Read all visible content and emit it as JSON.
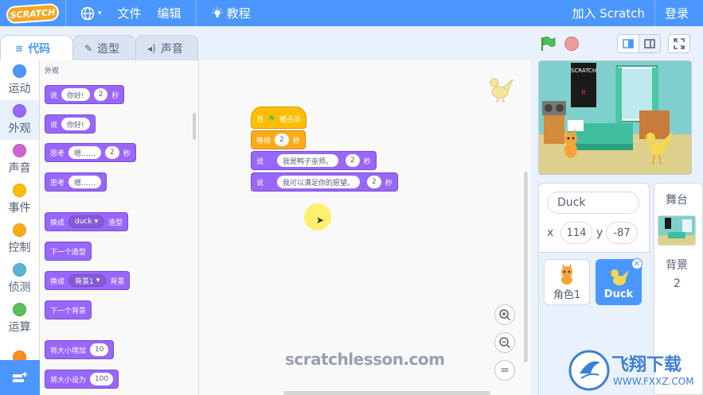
{
  "menu": {
    "logo": "SCRATCH",
    "file": "文件",
    "edit": "编辑",
    "tutorials": "教程",
    "join": "加入 Scratch",
    "signin": "登录"
  },
  "tabs": [
    {
      "label": "代码"
    },
    {
      "label": "造型"
    },
    {
      "label": "声音"
    }
  ],
  "categories": [
    {
      "label": "运动",
      "color": "#4c97ff"
    },
    {
      "label": "外观",
      "color": "#9966ff"
    },
    {
      "label": "声音",
      "color": "#cf63cf"
    },
    {
      "label": "事件",
      "color": "#ffbf00"
    },
    {
      "label": "控制",
      "color": "#ffab19"
    },
    {
      "label": "侦测",
      "color": "#5cb1d6"
    },
    {
      "label": "运算",
      "color": "#59c059"
    },
    {
      "label": "",
      "color": "#ff8c1a"
    }
  ],
  "palette": {
    "section_title": "外观",
    "say_for": {
      "say": "说",
      "text": "你好!",
      "secs": "2",
      "unit": "秒"
    },
    "say": {
      "say": "说",
      "text": "你好!"
    },
    "think_for": {
      "think": "思考",
      "text": "嗯……",
      "secs": "2",
      "unit": "秒"
    },
    "think": {
      "think": "思考",
      "text": "嗯……"
    },
    "switch_costume": {
      "prefix": "换成",
      "value": "duck",
      "suffix": "造型"
    },
    "next_costume": "下一个造型",
    "switch_backdrop": {
      "prefix": "换成",
      "value": "背景1",
      "suffix": "背景"
    },
    "next_backdrop": "下一个背景",
    "change_size": {
      "label": "将大小增加",
      "value": "10"
    },
    "set_size": {
      "label": "将大小设为",
      "value": "100"
    }
  },
  "script": {
    "hat": {
      "when": "当",
      "clicked": "被点击"
    },
    "wait": {
      "label": "等待",
      "secs": "2",
      "unit": "秒"
    },
    "say1": {
      "say": "说",
      "text": "我是鸭子巫师。",
      "secs": "2",
      "unit": "秒"
    },
    "say2": {
      "say": "说",
      "text": "我可以满足你的愿望。",
      "secs": "2",
      "unit": "秒"
    }
  },
  "zoom": {
    "in": "+",
    "out": "−",
    "reset": "="
  },
  "watermark": "scratchlesson.com",
  "sprite_info": {
    "name": "Duck",
    "x_label": "x",
    "x": "114",
    "y_label": "y",
    "y": "-87"
  },
  "sprites": [
    {
      "name": "角色1"
    },
    {
      "name": "Duck"
    }
  ],
  "stage_pane": {
    "title": "舞台",
    "backdrops_label": "背景",
    "backdrops_count": "2"
  },
  "site_logo": {
    "text": "飞翔下载",
    "url_text": "WWW.FXXZ.COM"
  },
  "colors": {
    "accent": "#4c97ff",
    "looks": "#9966ff",
    "events": "#ffbf00",
    "control": "#ffab19"
  }
}
